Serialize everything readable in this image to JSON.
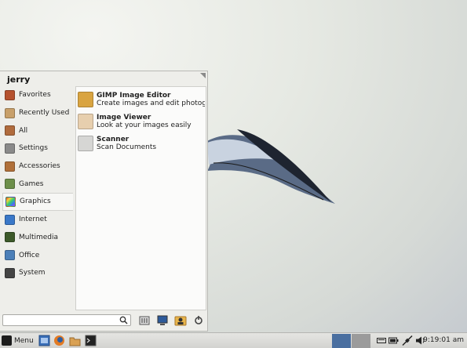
{
  "menu": {
    "user": "jerry",
    "categories": [
      {
        "label": "Favorites",
        "icon": "favorites-icon",
        "color": "#b5522e"
      },
      {
        "label": "Recently Used",
        "icon": "recently-used-icon",
        "color": "#c8a06a"
      },
      {
        "label": "All",
        "icon": "all-icon",
        "color": "#b06b3d"
      },
      {
        "label": "Settings",
        "icon": "settings-icon",
        "color": "#8a8a8a"
      },
      {
        "label": "Accessories",
        "icon": "accessories-icon",
        "color": "#b0703a"
      },
      {
        "label": "Games",
        "icon": "games-icon",
        "color": "#6d8f4a"
      },
      {
        "label": "Graphics",
        "icon": "graphics-icon",
        "color": "#e04ad0"
      },
      {
        "label": "Internet",
        "icon": "internet-icon",
        "color": "#3a78c8"
      },
      {
        "label": "Multimedia",
        "icon": "multimedia-icon",
        "color": "#3d5a2a"
      },
      {
        "label": "Office",
        "icon": "office-icon",
        "color": "#4b7fb8"
      },
      {
        "label": "System",
        "icon": "system-icon",
        "color": "#444444"
      }
    ],
    "selected_category": "Graphics",
    "apps": [
      {
        "title": "GIMP Image Editor",
        "desc": "Create images and edit photogra...",
        "icon": "gimp-icon",
        "color": "#d9a441"
      },
      {
        "title": "Image Viewer",
        "desc": "Look at your images easily",
        "icon": "image-viewer-icon",
        "color": "#e7cfae"
      },
      {
        "title": "Scanner",
        "desc": "Scan Documents",
        "icon": "scanner-icon",
        "color": "#d6d6d4"
      }
    ],
    "search": {
      "value": "",
      "placeholder": ""
    }
  },
  "taskbar": {
    "menu_label": "Menu",
    "clock": "9:19:01 am",
    "desktops": [
      "#4a6fa0",
      "#9b9b9b"
    ]
  }
}
